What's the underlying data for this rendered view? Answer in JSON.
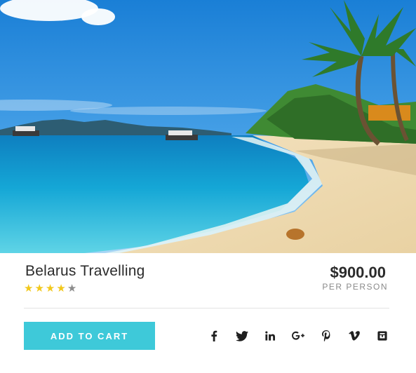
{
  "product": {
    "title": "Belarus Travelling",
    "rating": 4,
    "rating_max": 5,
    "price": "$900.00",
    "price_unit": "PER PERSON"
  },
  "actions": {
    "add_to_cart_label": "ADD TO CART"
  },
  "social": [
    {
      "name": "facebook-icon",
      "glyph": "f"
    },
    {
      "name": "twitter-icon",
      "glyph": ""
    },
    {
      "name": "linkedin-icon",
      "glyph": "in"
    },
    {
      "name": "google-plus-icon",
      "glyph": "g+"
    },
    {
      "name": "pinterest-icon",
      "glyph": "p"
    },
    {
      "name": "vimeo-icon",
      "glyph": "v"
    },
    {
      "name": "stumbleupon-icon",
      "glyph": ""
    }
  ],
  "colors": {
    "accent": "#3ec9d9",
    "star_on": "#f2c81b",
    "star_off": "#8c8c8c",
    "text": "#2b2b2b"
  }
}
